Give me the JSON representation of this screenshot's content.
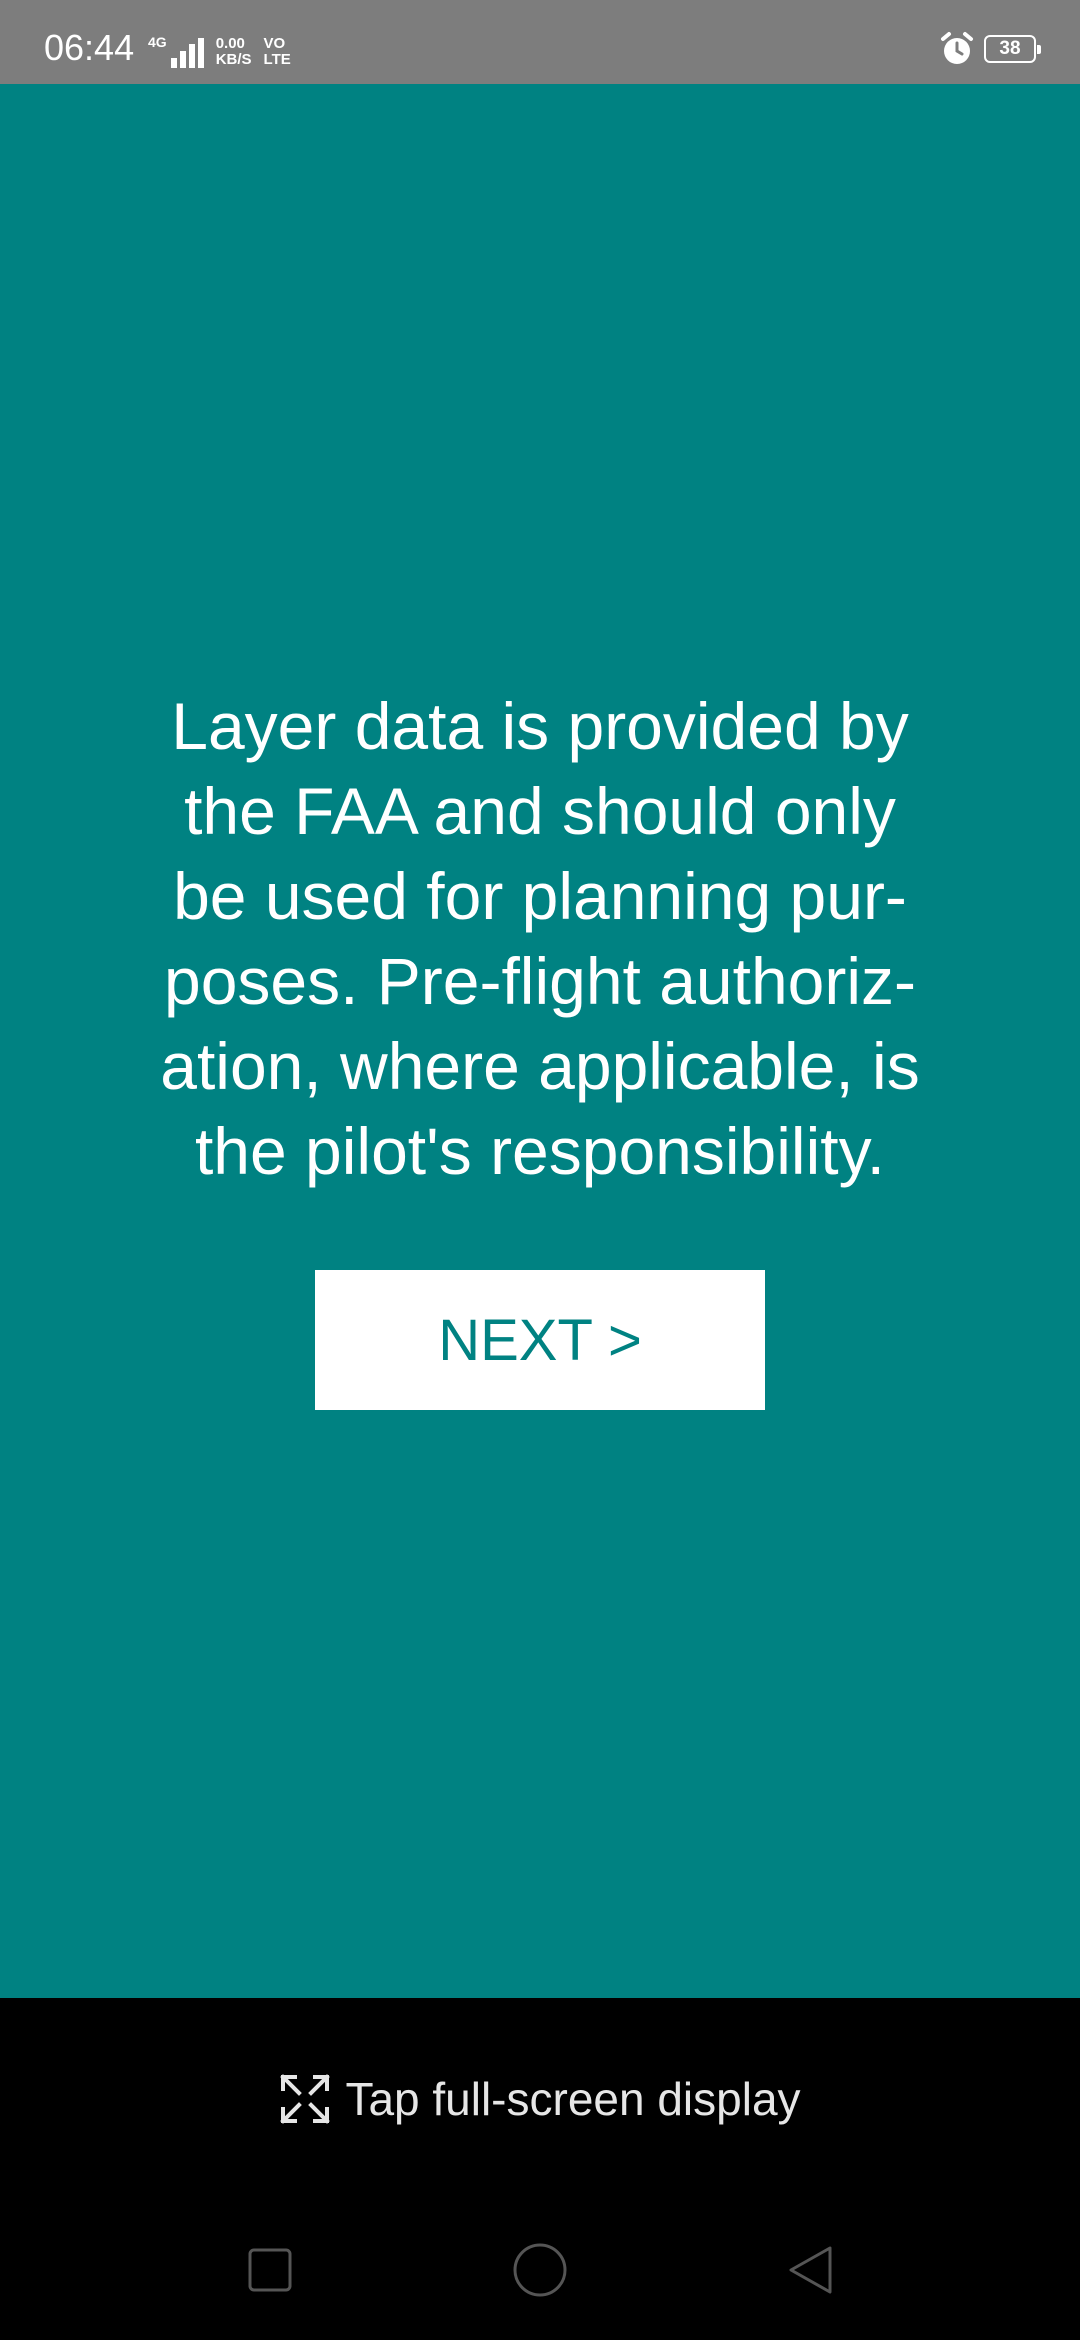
{
  "status_bar": {
    "time": "06:44",
    "network_type": "4G",
    "speed_value": "0.00",
    "speed_unit": "KB/S",
    "volte_top": "VO",
    "volte_bottom": "LTE",
    "battery_level": "38",
    "background_color": "#7d7d7d",
    "icons": [
      "signal-icon",
      "alarm-icon",
      "battery-icon"
    ]
  },
  "main": {
    "background_color": "#008282",
    "disclaimer_lines": [
      "Layer data is provided by",
      "the FAA and should only",
      "be used for planning pur-",
      "poses. Pre-flight authoriz-",
      "ation, where applicable, is",
      "the pilot's responsibility."
    ],
    "next_button_label": "NEXT >"
  },
  "fullscreen_hint": {
    "label": "Tap full-screen display",
    "icon": "expand-icon"
  },
  "nav_bar": {
    "icons": [
      "recent-apps-icon",
      "home-icon",
      "back-icon"
    ]
  }
}
